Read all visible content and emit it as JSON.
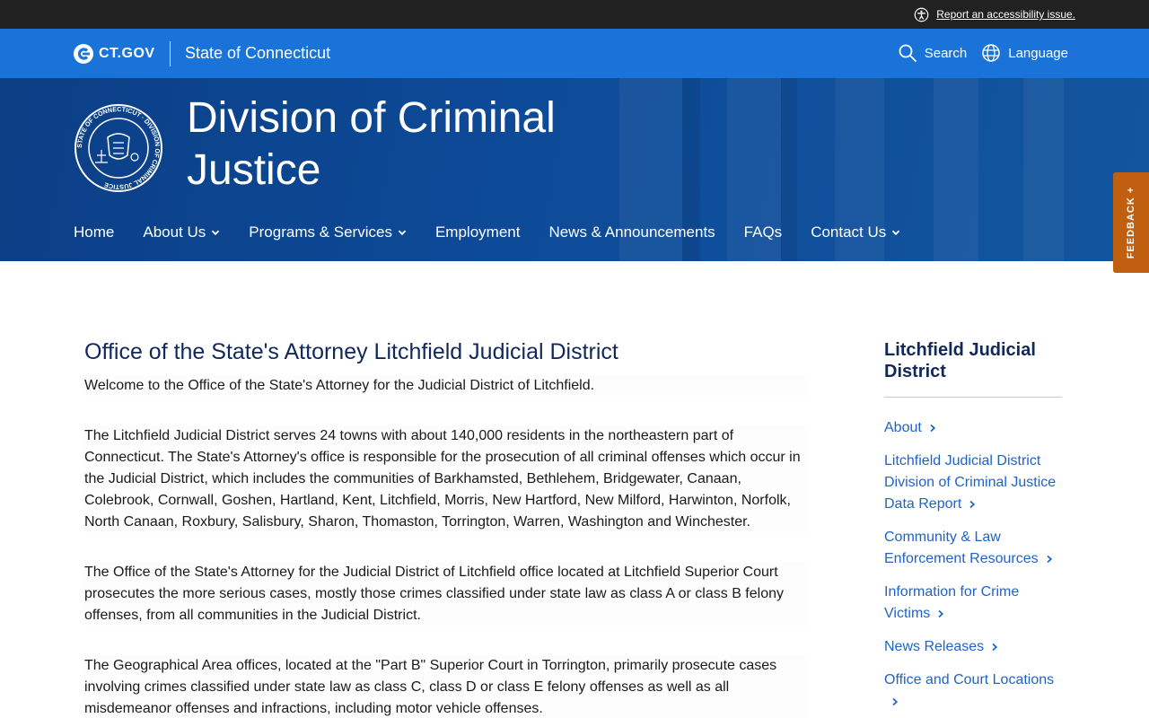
{
  "utility": {
    "accessibility_link": "Report an accessibility issue."
  },
  "gov_header": {
    "logo_text": "CT.GOV",
    "state_name": "State of Connecticut",
    "search_label": "Search",
    "language_label": "Language"
  },
  "agency": {
    "title": "Division of Criminal Justice",
    "seal_ring_text": "STATE OF CONNECTICUT · DIVISION OF CRIMINAL JUSTICE"
  },
  "nav": [
    {
      "label": "Home",
      "has_dropdown": false
    },
    {
      "label": "About Us",
      "has_dropdown": true
    },
    {
      "label": "Programs & Services",
      "has_dropdown": true
    },
    {
      "label": "Employment",
      "has_dropdown": false
    },
    {
      "label": "News & Announcements",
      "has_dropdown": false
    },
    {
      "label": "FAQs",
      "has_dropdown": false
    },
    {
      "label": "Contact Us",
      "has_dropdown": true
    }
  ],
  "feedback": {
    "label": "FEEDBACK +"
  },
  "main": {
    "title": "Office of the State's Attorney Litchfield Judicial District",
    "paragraphs": [
      "Welcome to the Office of the State's Attorney for the Judicial District of Litchfield.",
      "The Litchfield Judicial District serves 24 towns with about 140,000 residents in the northeastern part of Connecticut. The State's Attorney's office is responsible for the prosecution of all criminal offenses which occur in the Judicial District, which includes the communities of Barkhamsted, Bethlehem, Bridgewater, Canaan, Colebrook, Cornwall, Goshen, Hartland, Kent, Litchfield, Morris, New Hartford, New Milford, Harwinton, Norfolk, North Canaan, Roxbury, Salisbury, Sharon, Thomaston, Torrington, Warren, Washington and Winchester.",
      "The Office of the State's Attorney for the Judicial District of Litchfield office located at Litchfield Superior Court prosecutes the more serious cases, mostly those crimes classified under state law as class A or class B felony offenses, from all communities in the Judicial District.",
      "The Geographical Area offices, located at the \"Part B\" Superior Court in Torrington, primarily prosecute cases involving crimes classified under state law as class C, class D or class E felony offenses as well as all misdemeanor offenses and infractions, including motor vehicle offenses."
    ]
  },
  "sidebar": {
    "title": "Litchfield Judicial District",
    "links": [
      "About",
      "Litchfield Judicial District Division of Criminal Justice Data Report",
      "Community & Law Enforcement Resources",
      "Information for Crime Victims",
      "News Releases",
      "Office and Court Locations"
    ]
  },
  "colors": {
    "utility_bar": "#212121",
    "gov_bar": "#1a73d9",
    "banner": "#0d4a98",
    "title_text": "#10295a",
    "link": "#1f63c8",
    "feedback": "#c05f0f"
  }
}
